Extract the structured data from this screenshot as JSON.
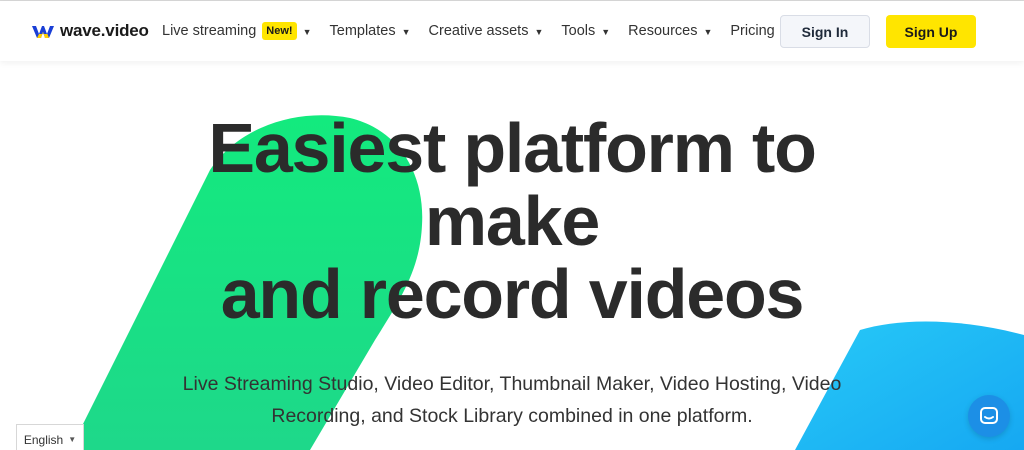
{
  "header": {
    "logo_text": "wave.video",
    "nav": [
      {
        "label": "Live streaming",
        "badge": "New!",
        "has_dropdown": true
      },
      {
        "label": "Templates",
        "has_dropdown": true
      },
      {
        "label": "Creative assets",
        "has_dropdown": true
      },
      {
        "label": "Tools",
        "has_dropdown": true
      },
      {
        "label": "Resources",
        "has_dropdown": true
      },
      {
        "label": "Pricing",
        "has_dropdown": false
      }
    ],
    "signin_label": "Sign In",
    "signup_label": "Sign Up"
  },
  "hero": {
    "title_lines": [
      "Easiest platform to",
      "make",
      "and record videos"
    ],
    "subtitle": "Live Streaming Studio, Video Editor, Thumbnail Maker, Video Hosting, Video Recording, and Stock Library combined in one platform."
  },
  "footer_widgets": {
    "language": "English"
  },
  "icons": {
    "logo": "wave-logo-icon",
    "dropdown": "chevron-down-icon",
    "chat": "chat-icon"
  },
  "colors": {
    "accent_yellow": "#ffe500",
    "green_shape": "#16e67a",
    "blue_shape": "#1cb8f5",
    "chat_button": "#1c8fe6",
    "logo_blue": "#1a3fd6",
    "logo_yellow": "#ffcf00"
  }
}
